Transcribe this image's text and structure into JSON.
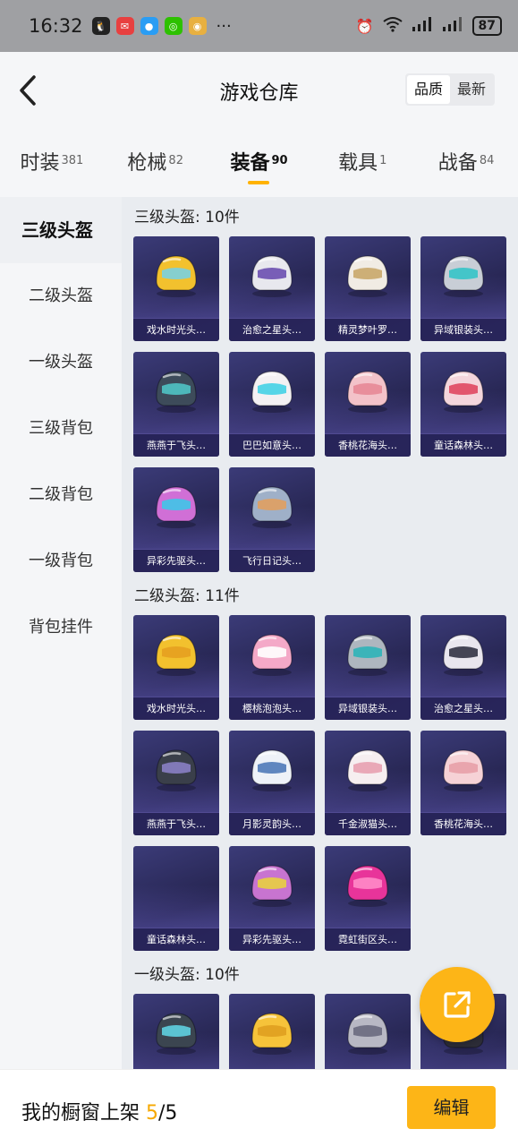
{
  "status_bar": {
    "time": "16:32",
    "battery": "87",
    "more": "···"
  },
  "header": {
    "title": "游戏仓库",
    "sort_quality": "品质",
    "sort_latest": "最新"
  },
  "tabs": [
    {
      "label": "时装",
      "count": "381"
    },
    {
      "label": "枪械",
      "count": "82"
    },
    {
      "label": "装备",
      "count": "90",
      "active": true
    },
    {
      "label": "载具",
      "count": "1"
    },
    {
      "label": "战备",
      "count": "84"
    }
  ],
  "sidebar": {
    "items": [
      "三级头盔",
      "二级头盔",
      "一级头盔",
      "三级背包",
      "二级背包",
      "一级背包",
      "背包挂件"
    ],
    "active_index": 0
  },
  "sections": [
    {
      "title": "三级头盔: 10件",
      "items": [
        {
          "name": "戏水时光头…",
          "color": "#f2c12e",
          "accent": "#7ad0e0",
          "icon": "helmet-icon"
        },
        {
          "name": "治愈之星头…",
          "color": "#e8e8ee",
          "accent": "#6b4fb0",
          "icon": "helmet-icon"
        },
        {
          "name": "精灵梦叶罗…",
          "color": "#f1ece4",
          "accent": "#c9a86a",
          "icon": "helmet-icon"
        },
        {
          "name": "异域银装头…",
          "color": "#c8ced6",
          "accent": "#35c4c8",
          "icon": "helmet-icon"
        },
        {
          "name": "燕燕于飞头…",
          "color": "#3d4b5a",
          "accent": "#4fc4c4",
          "icon": "helmet-icon"
        },
        {
          "name": "巴巴如意头…",
          "color": "#f4f1f3",
          "accent": "#45d2e6",
          "icon": "helmet-icon"
        },
        {
          "name": "香桃花海头…",
          "color": "#f3c2c9",
          "accent": "#e78896",
          "icon": "helmet-icon"
        },
        {
          "name": "童话森林头…",
          "color": "#f4d6dc",
          "accent": "#e04860",
          "icon": "helmet-icon"
        },
        {
          "name": "异彩先驱头…",
          "color": "#d06fd6",
          "accent": "#3fc5e8",
          "icon": "helmet-icon"
        },
        {
          "name": "飞行日记头…",
          "color": "#9fb0c8",
          "accent": "#e0a060",
          "icon": "helmet-icon"
        }
      ]
    },
    {
      "title": "二级头盔: 11件",
      "items": [
        {
          "name": "戏水时光头…",
          "color": "#f2c12e",
          "accent": "#e6a020",
          "icon": "helmet-icon"
        },
        {
          "name": "樱桃泡泡头…",
          "color": "#f4a9c8",
          "accent": "#ffffff",
          "icon": "helmet-icon"
        },
        {
          "name": "异域银装头…",
          "color": "#aeb6bf",
          "accent": "#2fb4b8",
          "icon": "helmet-icon"
        },
        {
          "name": "治愈之星头…",
          "color": "#e9e6ee",
          "accent": "#333344",
          "icon": "helmet-icon"
        },
        {
          "name": "燕燕于飞头…",
          "color": "#3a3f4a",
          "accent": "#8a7fc4",
          "icon": "helmet-icon"
        },
        {
          "name": "月影灵韵头…",
          "color": "#eef2f8",
          "accent": "#4f7ab8",
          "icon": "helmet-icon"
        },
        {
          "name": "千金淑猫头…",
          "color": "#f6eef0",
          "accent": "#e8a0b0",
          "icon": "helmet-icon"
        },
        {
          "name": "香桃花海头…",
          "color": "#f6d2d6",
          "accent": "#e8a0a8",
          "icon": "helmet-icon"
        },
        {
          "name": "童话森林头…",
          "color": "",
          "accent": "",
          "icon": "empty"
        },
        {
          "name": "异彩先驱头…",
          "color": "#c874d0",
          "accent": "#e8d040",
          "icon": "helmet-icon"
        },
        {
          "name": "霓虹街区头…",
          "color": "#e8349a",
          "accent": "#ff8ac8",
          "icon": "helmet-icon"
        }
      ]
    },
    {
      "title": "一级头盔: 10件",
      "items": [
        {
          "name": "",
          "color": "#3b4550",
          "accent": "#5fd0e0",
          "icon": "helmet-icon"
        },
        {
          "name": "",
          "color": "#f6c33a",
          "accent": "#e0a020",
          "icon": "helmet-icon"
        },
        {
          "name": "",
          "color": "#b8b8c4",
          "accent": "#6a6a80",
          "icon": "helmet-icon"
        },
        {
          "name": "",
          "color": "#2d2d38",
          "accent": "#8888a0",
          "icon": "helmet-icon"
        }
      ]
    }
  ],
  "bottom_bar": {
    "label": "我的橱窗上架",
    "current": "5",
    "total": "/5",
    "edit_label": "编辑"
  }
}
